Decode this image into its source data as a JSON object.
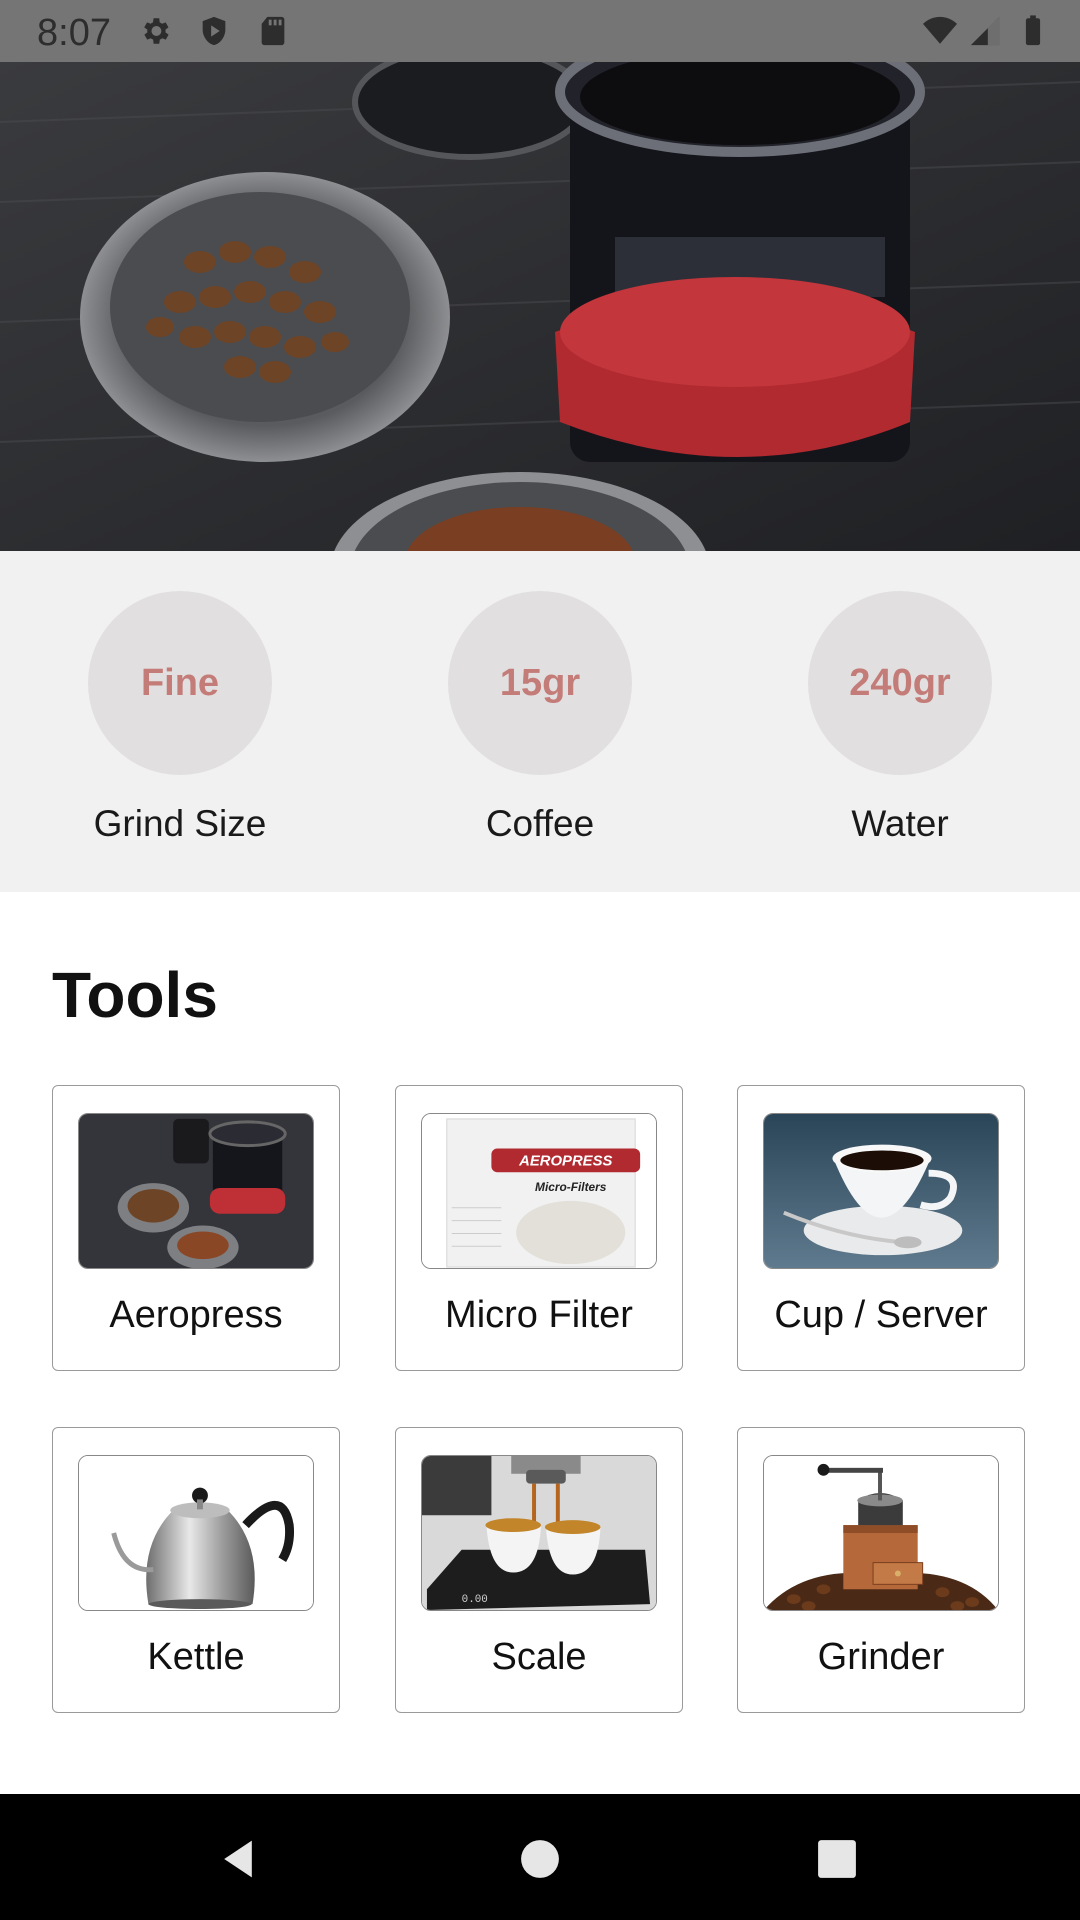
{
  "status_bar": {
    "time": "8:07",
    "left_icons": [
      "settings-icon",
      "shield-play-icon",
      "sd-card-icon"
    ],
    "right_icons": [
      "wifi-icon",
      "signal-icon",
      "battery-icon"
    ]
  },
  "hero": {
    "image": "aeropress-coffee-beans-photo"
  },
  "params": [
    {
      "value": "Fine",
      "label": "Grind Size"
    },
    {
      "value": "15gr",
      "label": "Coffee"
    },
    {
      "value": "240gr",
      "label": "Water"
    }
  ],
  "tools": {
    "title": "Tools",
    "items": [
      {
        "label": "Aeropress",
        "image": "aeropress-photo"
      },
      {
        "label": "Micro Filter",
        "image": "micro-filter-box-photo",
        "image_text": "AEROPRESS Micro-Filters"
      },
      {
        "label": "Cup / Server",
        "image": "coffee-cup-photo"
      },
      {
        "label": "Kettle",
        "image": "gooseneck-kettle-photo"
      },
      {
        "label": "Scale",
        "image": "espresso-scale-photo"
      },
      {
        "label": "Grinder",
        "image": "hand-grinder-photo"
      }
    ]
  },
  "colors": {
    "accent": "#c47c78",
    "param_circle": "#e1dfdf",
    "param_bg": "#f2f1f1",
    "status_bar": "#757575",
    "nav_bar": "#000000"
  },
  "nav": [
    "back-icon",
    "home-icon",
    "recents-icon"
  ]
}
